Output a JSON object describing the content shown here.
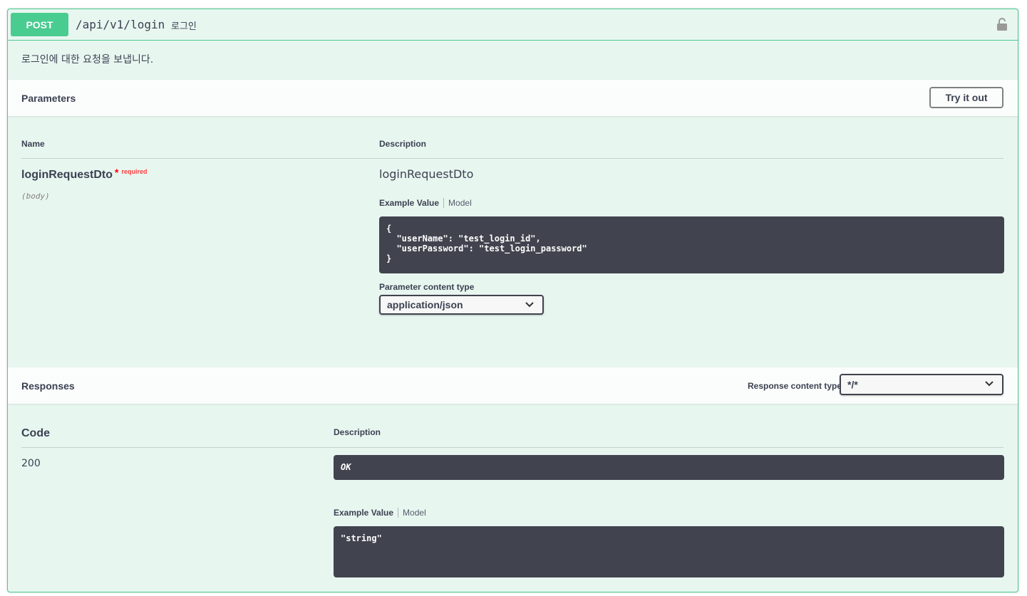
{
  "operation": {
    "method": "POST",
    "path": "/api/v1/login",
    "summary": "로그인",
    "description": "로그인에 대한 요청을 보냅니다."
  },
  "parameters": {
    "title": "Parameters",
    "try_button": "Try it out",
    "col_name": "Name",
    "col_description": "Description",
    "param": {
      "name": "loginRequestDto",
      "star": "*",
      "required": "required",
      "in": "(body)",
      "schema_title": "loginRequestDto",
      "tab_example": "Example Value",
      "tab_model": "Model",
      "example": "{\n  \"userName\": \"test_login_id\",\n  \"userPassword\": \"test_login_password\"\n}"
    },
    "content_type_label": "Parameter content type",
    "content_type_value": "application/json"
  },
  "responses": {
    "title": "Responses",
    "content_type_label": "Response content type",
    "content_type_value": "*/*",
    "col_code": "Code",
    "col_description": "Description",
    "items": [
      {
        "code": "200",
        "description": "OK",
        "tab_example": "Example Value",
        "tab_model": "Model",
        "example": "\"string\""
      }
    ]
  },
  "colors": {
    "post_accent": "#49cc90",
    "code_bg": "#41444e",
    "block_bg": "#e8f6f0"
  },
  "icons": {
    "lock": "unlocked-padlock-icon",
    "select_arrow": "chevron-down-icon"
  }
}
